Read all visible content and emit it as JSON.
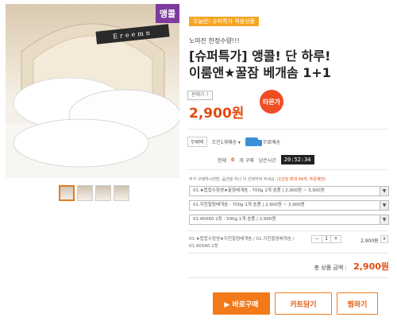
{
  "product": {
    "ribbon": "앵콜",
    "brand": "Ereemn",
    "thumbnails": 4
  },
  "info": {
    "today_badge": "오늘만! 슈퍼특가 적용상품",
    "subtitle": "노마진 한정수량!!!",
    "title_line1": "[슈퍼특가] 앵콜! 단 하루!",
    "title_line2": "이룸앤★꿀잠 베개솜 1+1",
    "price_chip": "판매가 ?",
    "price": "2,900원",
    "sale_badge": "타몬가"
  },
  "shipping": {
    "tag": "무배택",
    "option": "조건1개배송 ▾",
    "label": "무료배송"
  },
  "timer": {
    "label": "현재",
    "count": "0",
    "unit": "개 구매",
    "remain_label": "남은시간",
    "value": "20:52:34"
  },
  "notice": {
    "text": "추가 구매하시려면, 옵션을 하나 더 선택하여 주세요.",
    "highlight": "(1인당 최대 99개, 주문제한)"
  },
  "selects": [
    "01.★럽럽수험생★꿀잠베개솜 : 700g 1개 송품 | 2,900원 ~ 3,900원",
    "01.지친힐링베개솜 : 700g 1개 송품 | 2,900원 ~ 3,900원",
    "01.40X60 2장 : 500g 1개 송품 | 2,900원"
  ],
  "order": {
    "line1": "01.★럽럽수험생★지친힐링베개솜 / 01.지친힐링베개솜 /",
    "line2": "01.40X60.2장",
    "qty": "1",
    "minus": "−",
    "plus": "+",
    "line_price": "2,900원",
    "remove": "x"
  },
  "total": {
    "label": "총 상품 금액 :",
    "value": "2,900원"
  },
  "buttons": {
    "buy": "▶ 바로구매",
    "cart": "카트담기",
    "wish": "찜하기"
  },
  "colors": {
    "accent": "#f27a1a",
    "price": "#e34a0e",
    "ribbon": "#7e3a9c"
  }
}
